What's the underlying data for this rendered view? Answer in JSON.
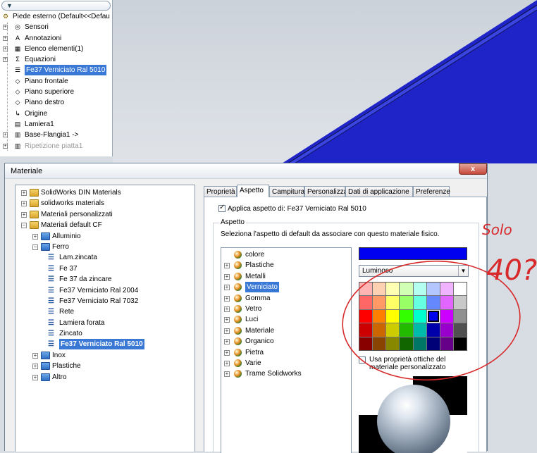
{
  "feature_tree": {
    "root": "Piede esterno  (Default<<Defau",
    "items": [
      {
        "label": "Sensori",
        "icon": "sensor-icon"
      },
      {
        "label": "Annotazioni",
        "icon": "annotation-icon"
      },
      {
        "label": "Elenco elementi(1)",
        "icon": "list-icon"
      },
      {
        "label": "Equazioni",
        "icon": "equation-icon"
      },
      {
        "label": "Fe37 Verniciato Ral 5010",
        "icon": "material-icon"
      },
      {
        "label": "Piano frontale",
        "icon": "plane-icon"
      },
      {
        "label": "Piano superiore",
        "icon": "plane-icon"
      },
      {
        "label": "Piano destro",
        "icon": "plane-icon"
      },
      {
        "label": "Origine",
        "icon": "origin-icon"
      },
      {
        "label": "Lamiera1",
        "icon": "sheetmetal-icon"
      },
      {
        "label": "Base-Flangia1 ->",
        "icon": "flange-icon"
      },
      {
        "label": "Ripetizione piatta1",
        "icon": "flat-pattern-icon"
      }
    ]
  },
  "dialog": {
    "title": "Materiale",
    "close": "x",
    "tabs": [
      "Proprietà",
      "Aspetto",
      "Campitura",
      "Personalizza",
      "Dati di applicazione",
      "Preferenze"
    ],
    "apply_label": "Applica aspetto di: Fe37 Verniciato Ral 5010",
    "group_legend": "Aspetto",
    "group_desc": "Seleziona l'aspetto di default da associare con questo materiale fisico.",
    "finish": "Luminoso",
    "optics_label": "Usa proprietà ottiche del materiale personalizzato"
  },
  "material_tree": [
    {
      "label": "SolidWorks DIN Materials",
      "level": 0
    },
    {
      "label": "solidworks materials",
      "level": 0
    },
    {
      "label": "Materiali personalizzati",
      "level": 0
    },
    {
      "label": "Materiali default CF",
      "level": 0
    },
    {
      "label": "Alluminio",
      "level": 1
    },
    {
      "label": "Ferro",
      "level": 1
    },
    {
      "label": "Lam.zincata",
      "level": 2
    },
    {
      "label": "Fe 37",
      "level": 2
    },
    {
      "label": "Fe 37 da zincare",
      "level": 2
    },
    {
      "label": "Fe37 Verniciato Ral 2004",
      "level": 2
    },
    {
      "label": "Fe37 Verniciato Ral 7032",
      "level": 2
    },
    {
      "label": "Rete",
      "level": 2
    },
    {
      "label": "Lamiera forata",
      "level": 2
    },
    {
      "label": "Zincato",
      "level": 2
    },
    {
      "label": "Fe37 Verniciato Ral 5010",
      "level": 2
    },
    {
      "label": "Inox",
      "level": 1
    },
    {
      "label": "Plastiche",
      "level": 1
    },
    {
      "label": "Altro",
      "level": 1
    }
  ],
  "appearance_tree": [
    "colore",
    "Plastiche",
    "Metalli",
    "Verniciato",
    "Gomma",
    "Vetro",
    "Luci",
    "Materiale",
    "Organico",
    "Pietra",
    "Varie",
    "Trame Solidworks"
  ],
  "colors": {
    "selected": "#0000f0",
    "palette": [
      "#ffb3b3",
      "#ffd1b3",
      "#ffffb3",
      "#d1ffb3",
      "#b3fff0",
      "#b3c6ff",
      "#f0b3ff",
      "#ffffff",
      "#ff6666",
      "#ff9966",
      "#ffff66",
      "#99ff66",
      "#66ffe0",
      "#6688ff",
      "#e066ff",
      "#c8c8c8",
      "#ff0000",
      "#ff8000",
      "#ffff00",
      "#33ff00",
      "#00ffcc",
      "#0000f0",
      "#cc00ff",
      "#909090",
      "#cc0000",
      "#cc6600",
      "#cccc00",
      "#22bb00",
      "#00bbaa",
      "#0000aa",
      "#9900cc",
      "#505050",
      "#880000",
      "#884400",
      "#888800",
      "#116600",
      "#007766",
      "#000077",
      "#660088",
      "#000000"
    ]
  },
  "handwriting": {
    "line1": "Solo",
    "line2": "40?"
  }
}
